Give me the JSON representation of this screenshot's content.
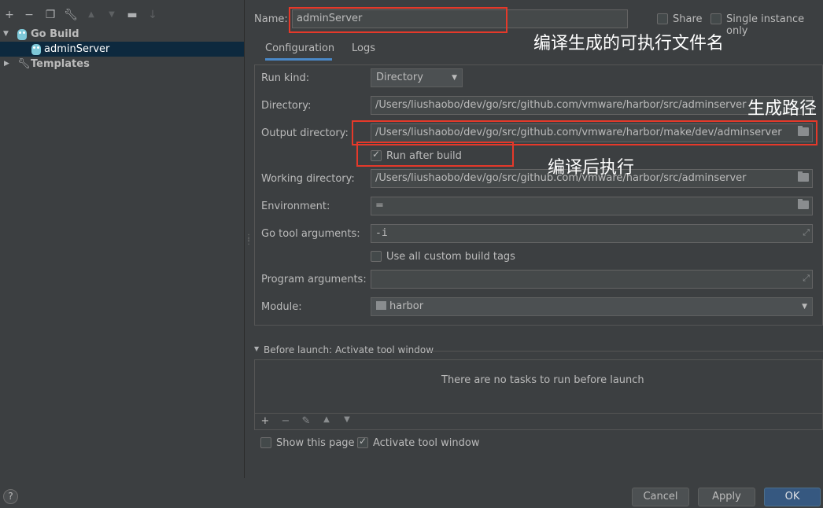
{
  "toolbar": {
    "icons": [
      "plus-icon",
      "minus-icon",
      "copy-icon",
      "wrench-icon",
      "arrow-up-icon",
      "arrow-down-icon",
      "folder-add-icon",
      "sort-icon"
    ]
  },
  "tree": {
    "group_label": "Go Build",
    "selected_label": "adminServer",
    "templates_label": "Templates"
  },
  "header": {
    "name_label": "Name:",
    "name_value": "adminServer",
    "share_label": "Share",
    "single_instance_label": "Single instance only"
  },
  "tabs": [
    "Configuration",
    "Logs"
  ],
  "form": {
    "run_kind_label": "Run kind:",
    "run_kind_value": "Directory",
    "directory_label": "Directory:",
    "directory_value": "/Users/liushaobo/dev/go/src/github.com/vmware/harbor/src/adminserver",
    "output_dir_label": "Output directory:",
    "output_dir_value": "/Users/liushaobo/dev/go/src/github.com/vmware/harbor/make/dev/adminserver",
    "run_after_build_label": "Run after build",
    "working_dir_label": "Working directory:",
    "working_dir_value": "/Users/liushaobo/dev/go/src/github.com/vmware/harbor/src/adminserver",
    "environment_label": "Environment:",
    "environment_value": "=",
    "go_tool_args_label": "Go tool arguments:",
    "go_tool_args_value": "-i",
    "custom_tags_label": "Use all custom build tags",
    "program_args_label": "Program arguments:",
    "program_args_value": "",
    "module_label": "Module:",
    "module_value": "harbor"
  },
  "before_launch": {
    "title": "Before launch: Activate tool window",
    "empty_text": "There are no tasks to run before launch"
  },
  "options": {
    "show_page_label": "Show this page",
    "activate_label": "Activate tool window"
  },
  "buttons": {
    "cancel": "Cancel",
    "apply": "Apply",
    "ok": "OK",
    "help": "?"
  },
  "annotations": {
    "name_note": "编译生成的可执行文件名",
    "output_note": "生成路径",
    "run_note": "编译后执行"
  },
  "colors": {
    "background": "#3c3f41",
    "selection": "#0d293e",
    "highlight_box": "#e5392a",
    "tab_underline": "#4a88c7",
    "ok_button": "#365880"
  }
}
